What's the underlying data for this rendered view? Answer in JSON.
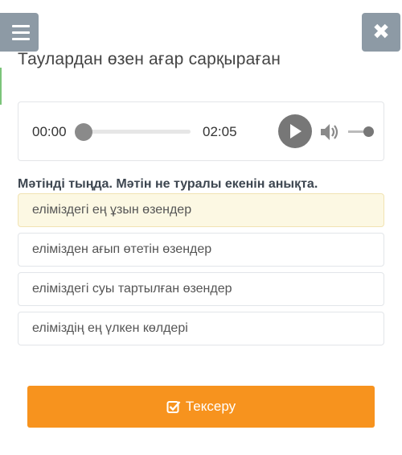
{
  "header": {
    "menu_icon": "hamburger-menu-icon",
    "close_icon": "close-x-icon",
    "close_glyph": "✖"
  },
  "title": "Таулардан өзен ағар сарқыраған",
  "audio": {
    "current_time": "00:00",
    "duration": "02:05",
    "progress": 0,
    "play_icon": "play-icon",
    "volume_icon": "volume-icon"
  },
  "question": "Мәтінді тыңда. Мәтін не туралы екенін анықта.",
  "options": [
    {
      "label": "еліміздегі ең ұзын өзендер",
      "selected": true
    },
    {
      "label": "елімізден ағып өтетін өзендер",
      "selected": false
    },
    {
      "label": "еліміздегі суы тартылған өзендер",
      "selected": false
    },
    {
      "label": "еліміздің ең үлкен көлдері",
      "selected": false
    }
  ],
  "submit": {
    "label": "Тексеру",
    "icon": "check-square-icon"
  },
  "colors": {
    "accent": "#f7931e",
    "selected_bg": "#fcf8e3",
    "header_btn": "#8d9aa5"
  }
}
